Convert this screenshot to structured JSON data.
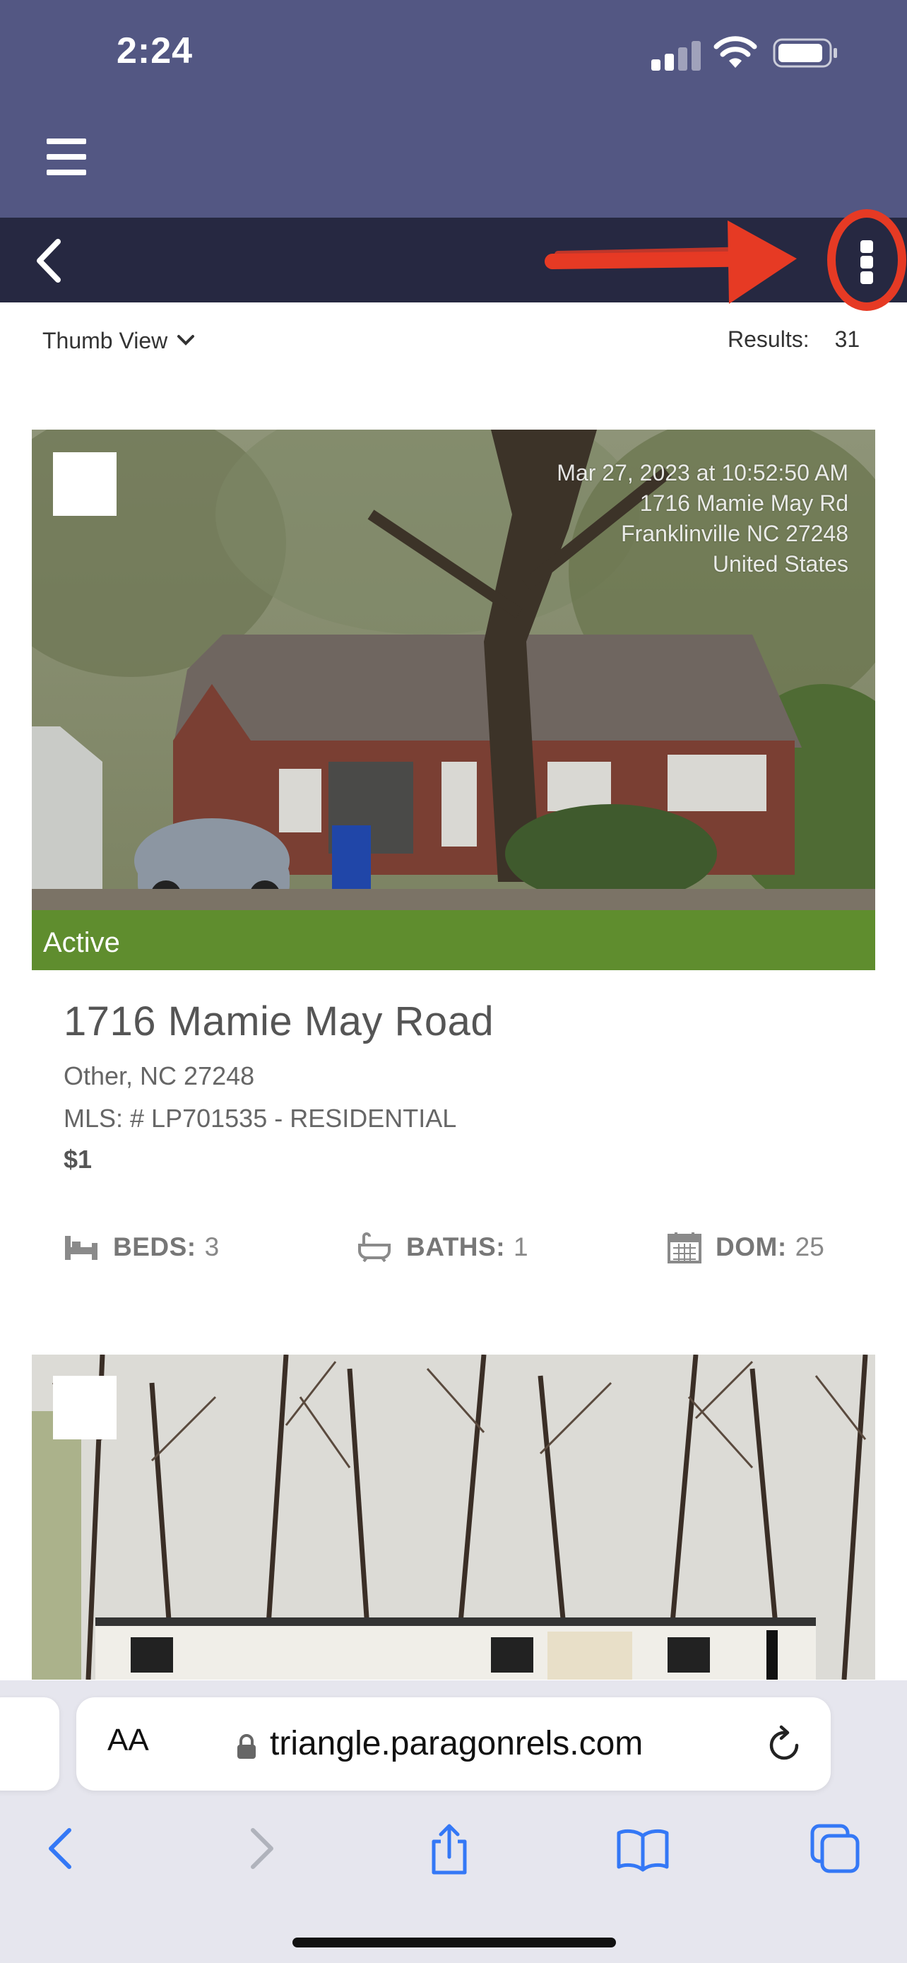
{
  "status_bar": {
    "time": "2:24"
  },
  "toolbar": {
    "view_label": "Thumb View",
    "results_label": "Results:",
    "results_count": "31"
  },
  "listing": {
    "status": "Active",
    "photo_stamp": [
      "Mar 27, 2023 at 10:52:50 AM",
      "1716 Mamie May Rd",
      "Franklinville NC 27248",
      "United States"
    ],
    "address": "1716 Mamie May Road",
    "city_line": "Other, NC 27248",
    "mls_line": "MLS: # LP701535 - RESIDENTIAL",
    "price": "$1",
    "beds_label": "BEDS:",
    "beds": "3",
    "baths_label": "BATHS:",
    "baths": "1",
    "dom_label": "DOM:",
    "dom": "25"
  },
  "browser": {
    "text_size_label": "AA",
    "url": "triangle.paragonrels.com"
  },
  "colors": {
    "header_bg": "#535783",
    "navbar_bg": "#262841",
    "annotation": "#e63a24",
    "safari_bg": "#e6e6ee",
    "safari_tint": "#3478f6"
  }
}
